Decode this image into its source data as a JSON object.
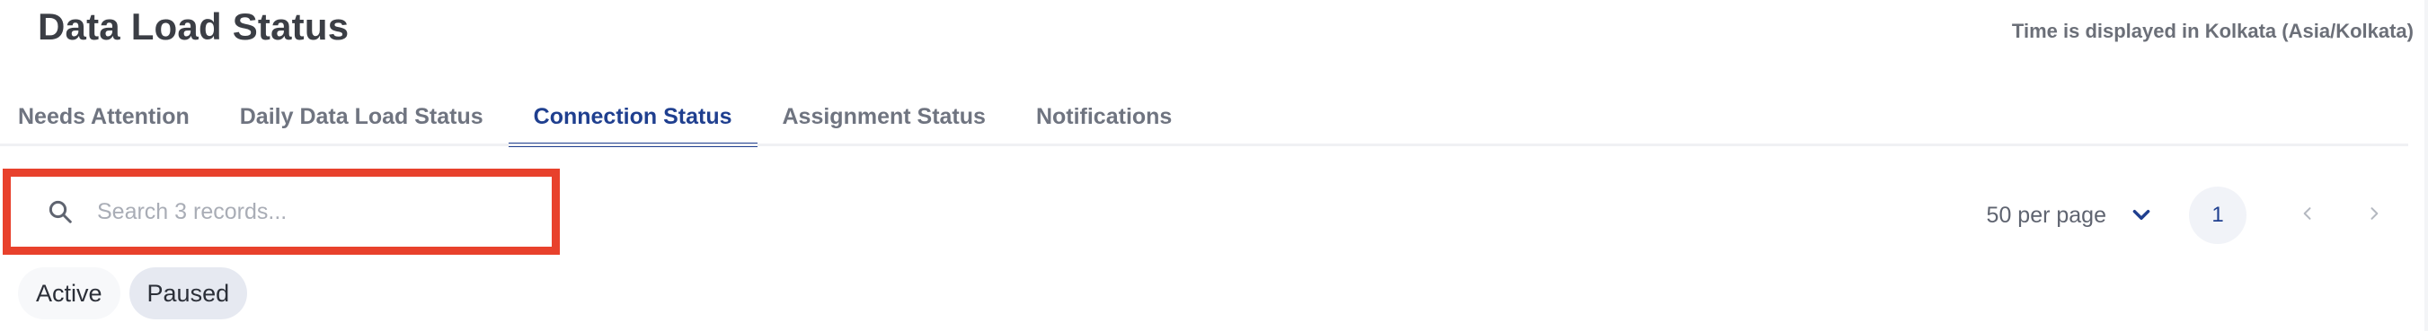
{
  "header": {
    "title": "Data Load Status",
    "timezone_note": "Time is displayed in Kolkata (Asia/Kolkata)"
  },
  "tabs": [
    {
      "label": "Needs Attention",
      "active": false
    },
    {
      "label": "Daily Data Load Status",
      "active": false
    },
    {
      "label": "Connection Status",
      "active": true
    },
    {
      "label": "Assignment Status",
      "active": false
    },
    {
      "label": "Notifications",
      "active": false
    }
  ],
  "search": {
    "placeholder": "Search 3 records...",
    "value": "",
    "icon": "search-icon"
  },
  "pagination": {
    "per_page_label": "50 per page",
    "current_page": "1",
    "prev_icon": "chevron-left-icon",
    "next_icon": "chevron-right-icon"
  },
  "filters": [
    {
      "label": "Active",
      "selected": false
    },
    {
      "label": "Paused",
      "selected": true
    }
  ],
  "colors": {
    "accent": "#1f3f8f",
    "highlight": "#e8412c",
    "chip_selected": "#e6e9f1"
  }
}
